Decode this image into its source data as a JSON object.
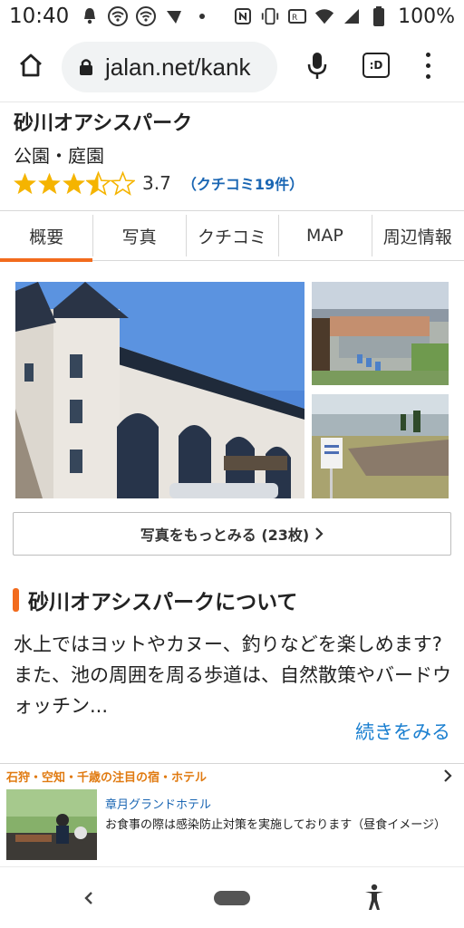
{
  "status_bar": {
    "time": "10:40",
    "battery": "100%",
    "icons": [
      "notification-icon",
      "wifi-icon",
      "wifi-icon",
      "network-icon",
      "dot-icon",
      "nfc-icon",
      "vibrate-icon",
      "data-saver-icon",
      "wifi-signal-icon",
      "cell-signal-icon",
      "battery-icon"
    ]
  },
  "browser": {
    "url": "jalan.net/kank",
    "tab_count_label": ":D"
  },
  "spot": {
    "title": "砂川オアシスパーク",
    "category": "公園・庭園",
    "rating": 3.7,
    "rating_text": "3.7",
    "review_link": "（クチコミ19件）"
  },
  "tabs": [
    {
      "label": "概要",
      "active": true
    },
    {
      "label": "写真",
      "active": false
    },
    {
      "label": "クチコミ",
      "active": false
    },
    {
      "label": "MAP",
      "active": false
    },
    {
      "label": "周辺情報",
      "active": false
    }
  ],
  "photos": {
    "more_label": "写真をもっとみる (23枚)"
  },
  "about": {
    "title": "砂川オアシスパークについて",
    "text": "水上ではヨットやカヌー、釣りなどを楽しめます?また、池の周囲を周る歩道は、自然散策やバードウォッチン...",
    "read_more": "続きをみる"
  },
  "banner": {
    "heading": "石狩・空知・千歳の注目の宿・ホテル",
    "hotel_name": "章月グランドホテル",
    "description": "お食事の際は感染防止対策を実施しております（昼食イメージ）"
  },
  "colors": {
    "accent": "#f26b1d",
    "link": "#1a66b3",
    "star": "#f5b400"
  }
}
